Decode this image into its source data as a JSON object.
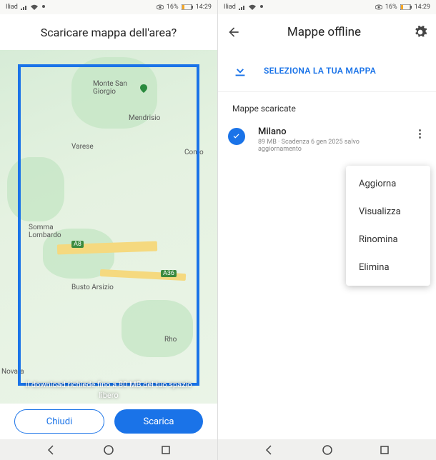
{
  "status": {
    "carrier": "Iliad",
    "battery": "16%",
    "time": "14:29"
  },
  "left": {
    "title": "Scaricare mappa dell'area?",
    "places": {
      "monte": "Monte San\nGiorgio",
      "mendrisio": "Mendrisio",
      "varese": "Varese",
      "como": "Como",
      "somma": "Somma\nLombardo",
      "busto": "Busto Arsizio",
      "rho": "Rho",
      "novara": "Novara",
      "a8": "A8",
      "a36": "A36"
    },
    "download_text": "Il download richiede fino a 80 MB del tuo spazio libero",
    "close": "Chiudi",
    "download": "Scarica"
  },
  "right": {
    "title": "Mappe offline",
    "select": "SELEZIONA LA TUA MAPPA",
    "section": "Mappe scaricate",
    "item": {
      "name": "Milano",
      "sub": "89 MB · Scadenza 6 gen 2025 salvo aggiornamento"
    },
    "menu": {
      "update": "Aggiorna",
      "view": "Visualizza",
      "rename": "Rinomina",
      "delete": "Elimina"
    }
  }
}
